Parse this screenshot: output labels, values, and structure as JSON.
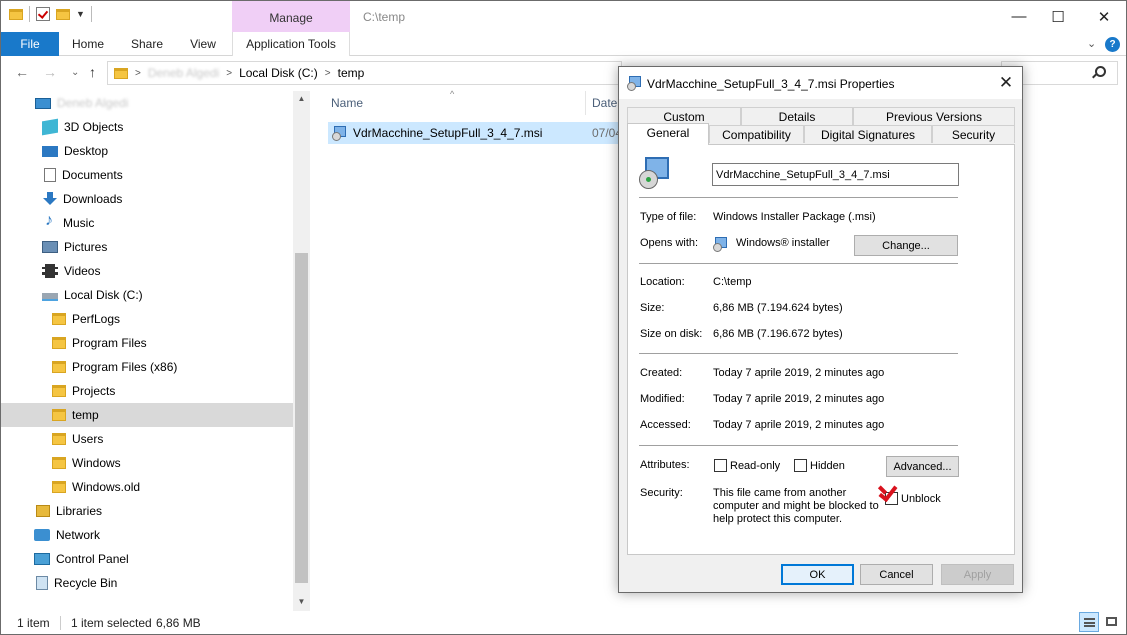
{
  "window": {
    "title_path": "C:\\temp",
    "context_tab": "Manage",
    "controls": {
      "minimize": "—",
      "maximize": "☐",
      "close": "✕"
    }
  },
  "ribbon": {
    "tabs": [
      "File",
      "Home",
      "Share",
      "View",
      "Application Tools"
    ],
    "collapse_glyph": "⌄",
    "help_glyph": "?"
  },
  "address": {
    "back": "←",
    "forward": "→",
    "recent": "⌄",
    "up": "↑",
    "crumbs": [
      "Deneb Algedi",
      "Local Disk (C:)",
      "temp"
    ],
    "sep": ">"
  },
  "nav": {
    "items": [
      {
        "label": "Deneb Algedi",
        "icon": "pc-icon",
        "blurred": true
      },
      {
        "label": "3D Objects",
        "icon": "cube-icon"
      },
      {
        "label": "Desktop",
        "icon": "desktop-icon"
      },
      {
        "label": "Documents",
        "icon": "documents-icon"
      },
      {
        "label": "Downloads",
        "icon": "download-icon"
      },
      {
        "label": "Music",
        "icon": "music-icon"
      },
      {
        "label": "Pictures",
        "icon": "pictures-icon"
      },
      {
        "label": "Videos",
        "icon": "videos-icon"
      },
      {
        "label": "Local Disk (C:)",
        "icon": "disk-icon"
      },
      {
        "label": "PerfLogs",
        "icon": "folder-icon"
      },
      {
        "label": "Program Files",
        "icon": "folder-icon"
      },
      {
        "label": "Program Files (x86)",
        "icon": "folder-icon"
      },
      {
        "label": "Projects",
        "icon": "folder-icon"
      },
      {
        "label": "temp",
        "icon": "folder-icon",
        "selected": true
      },
      {
        "label": "Users",
        "icon": "folder-icon"
      },
      {
        "label": "Windows",
        "icon": "folder-icon"
      },
      {
        "label": "Windows.old",
        "icon": "folder-icon"
      },
      {
        "label": "Libraries",
        "icon": "libraries-icon"
      },
      {
        "label": "Network",
        "icon": "network-icon"
      },
      {
        "label": "Control Panel",
        "icon": "control-panel-icon"
      },
      {
        "label": "Recycle Bin",
        "icon": "recycle-bin-icon"
      }
    ],
    "scroll_up": "▲",
    "scroll_down": "▼"
  },
  "file_list": {
    "columns": [
      "Name",
      "Date"
    ],
    "sort_glyph": "^",
    "rows": [
      {
        "name": "VdrMacchine_SetupFull_3_4_7.msi",
        "date": "07/04"
      }
    ]
  },
  "status": {
    "count": "1 item",
    "selection": "1 item selected",
    "size": "6,86 MB"
  },
  "dialog": {
    "title": "VdrMacchine_SetupFull_3_4_7.msi Properties",
    "close_glyph": "✕",
    "tabs_row1": [
      "Custom",
      "Details",
      "Previous Versions"
    ],
    "tabs_row2": [
      "General",
      "Compatibility",
      "Digital Signatures",
      "Security"
    ],
    "active_tab": "General",
    "file_name": "VdrMacchine_SetupFull_3_4_7.msi",
    "fields": {
      "type_label": "Type of file:",
      "type_value": "Windows Installer Package (.msi)",
      "opens_label": "Opens with:",
      "opens_value": "Windows® installer",
      "change_button": "Change...",
      "location_label": "Location:",
      "location_value": "C:\\temp",
      "size_label": "Size:",
      "size_value": "6,86 MB (7.194.624 bytes)",
      "size_disk_label": "Size on disk:",
      "size_disk_value": "6,86 MB (7.196.672 bytes)",
      "created_label": "Created:",
      "created_value": "Today 7 aprile 2019, 2 minutes ago",
      "modified_label": "Modified:",
      "modified_value": "Today 7 aprile 2019, 2 minutes ago",
      "accessed_label": "Accessed:",
      "accessed_value": "Today 7 aprile 2019, 2 minutes ago",
      "attributes_label": "Attributes:",
      "readonly_label": "Read-only",
      "hidden_label": "Hidden",
      "advanced_button": "Advanced...",
      "security_label": "Security:",
      "security_text": "This file came from another computer and might be blocked to help protect this computer.",
      "unblock_label": "Unblock"
    },
    "buttons": {
      "ok": "OK",
      "cancel": "Cancel",
      "apply": "Apply"
    },
    "colors": {
      "tick": "#d9121e",
      "accent": "#0078d7"
    }
  }
}
